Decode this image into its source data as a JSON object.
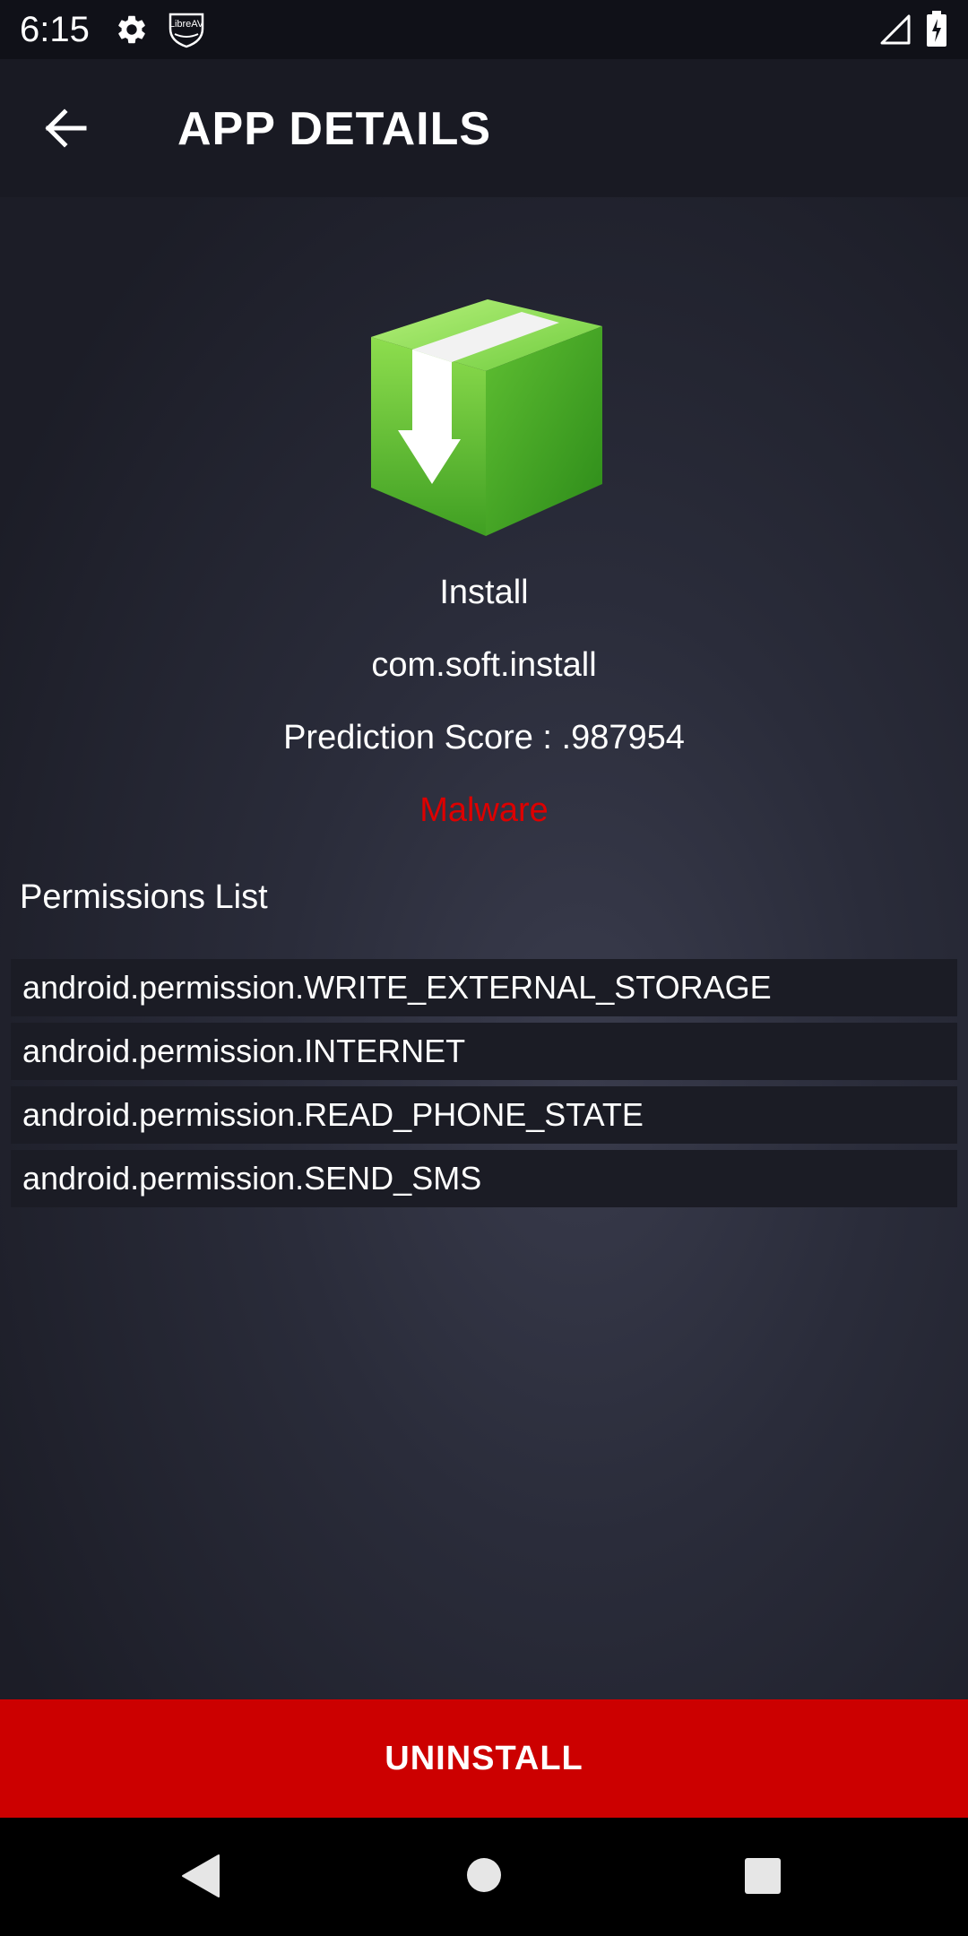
{
  "status_bar": {
    "time": "6:15",
    "icons": [
      "gear-icon",
      "libreav-shield-icon",
      "signal-icon",
      "battery-icon"
    ],
    "shield_label": "LibreAV"
  },
  "app_bar": {
    "title": "APP DETAILS",
    "back_icon": "arrow-left-icon"
  },
  "app_info": {
    "icon": "green-package-box-icon",
    "name": "Install",
    "package": "com.soft.install",
    "score_label": "Prediction Score : ",
    "score_value": ".987954",
    "verdict": "Malware",
    "verdict_color": "#dd0000"
  },
  "permissions": {
    "heading": "Permissions List",
    "items": [
      "android.permission.WRITE_EXTERNAL_STORAGE",
      "android.permission.INTERNET",
      "android.permission.READ_PHONE_STATE",
      "android.permission.SEND_SMS"
    ]
  },
  "uninstall_button": {
    "label": "UNINSTALL",
    "color": "#cc0000"
  },
  "nav_bar": {
    "icons": [
      "back-triangle-icon",
      "home-circle-icon",
      "recents-square-icon"
    ]
  }
}
